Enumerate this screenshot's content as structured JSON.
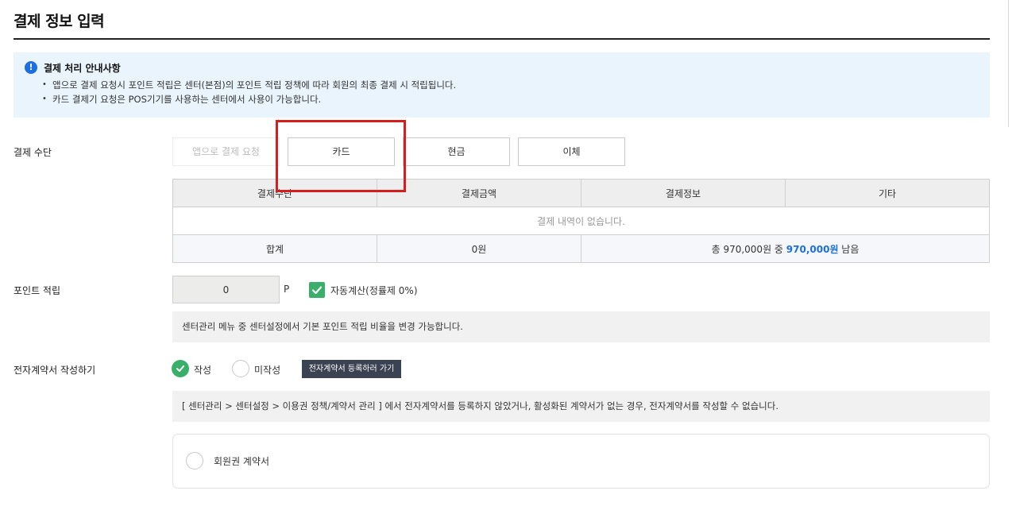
{
  "page": {
    "title": "결제 정보 입력"
  },
  "notice": {
    "icon": "info-icon",
    "icon_glyph": "!",
    "title": "결제 처리 안내사항",
    "items": [
      "앱으로 결제 요청시 포인트 적립은 센터(본점)의 포인트 적립 정책에 따라 회원의 최종 결제 시 적립됩니다.",
      "카드 결제기 요청은 POS기기를 사용하는 센터에서 사용이 가능합니다."
    ]
  },
  "payment": {
    "label": "결제 수단",
    "methods": [
      {
        "label": "앱으로 결제 요청",
        "disabled": true
      },
      {
        "label": "카드",
        "disabled": false
      },
      {
        "label": "현금",
        "disabled": false
      },
      {
        "label": "이체",
        "disabled": false
      }
    ],
    "table": {
      "headers": [
        "결제수단",
        "결제금액",
        "결제정보",
        "기타"
      ],
      "empty_message": "결제 내역이 없습니다.",
      "total_label": "합계",
      "total_amount": "0원",
      "remaining_prefix": "총 970,000원 중 ",
      "remaining_amount": "970,000원",
      "remaining_suffix": " 남음"
    }
  },
  "points": {
    "label": "포인트 적립",
    "value": "0",
    "unit": "P",
    "auto_calc_label": "자동계산(정률제 0%)",
    "auto_calc_checked": true,
    "info": "센터관리 메뉴 중 센터설정에서 기본 포인트 적립 비율을 변경 가능합니다."
  },
  "contract": {
    "label": "전자계약서 작성하기",
    "options": [
      {
        "label": "작성",
        "checked": true
      },
      {
        "label": "미작성",
        "checked": false
      }
    ],
    "goto_button": "전자계약서 등록하러 가기",
    "info": "[ 센터관리 > 센터설정 > 이용권 정책/계약서 관리 ] 에서 전자계약서를 등록하지 않았거나, 활성화된 계약서가 없는 경우, 전자계약서를 작성할 수 없습니다.",
    "card_option": "회원권 계약서"
  },
  "colors": {
    "accent": "#1d6fe0",
    "check_green": "#3aaf6b",
    "highlight_red": "#d71e1e",
    "notice_bg": "#e9f4fc"
  }
}
